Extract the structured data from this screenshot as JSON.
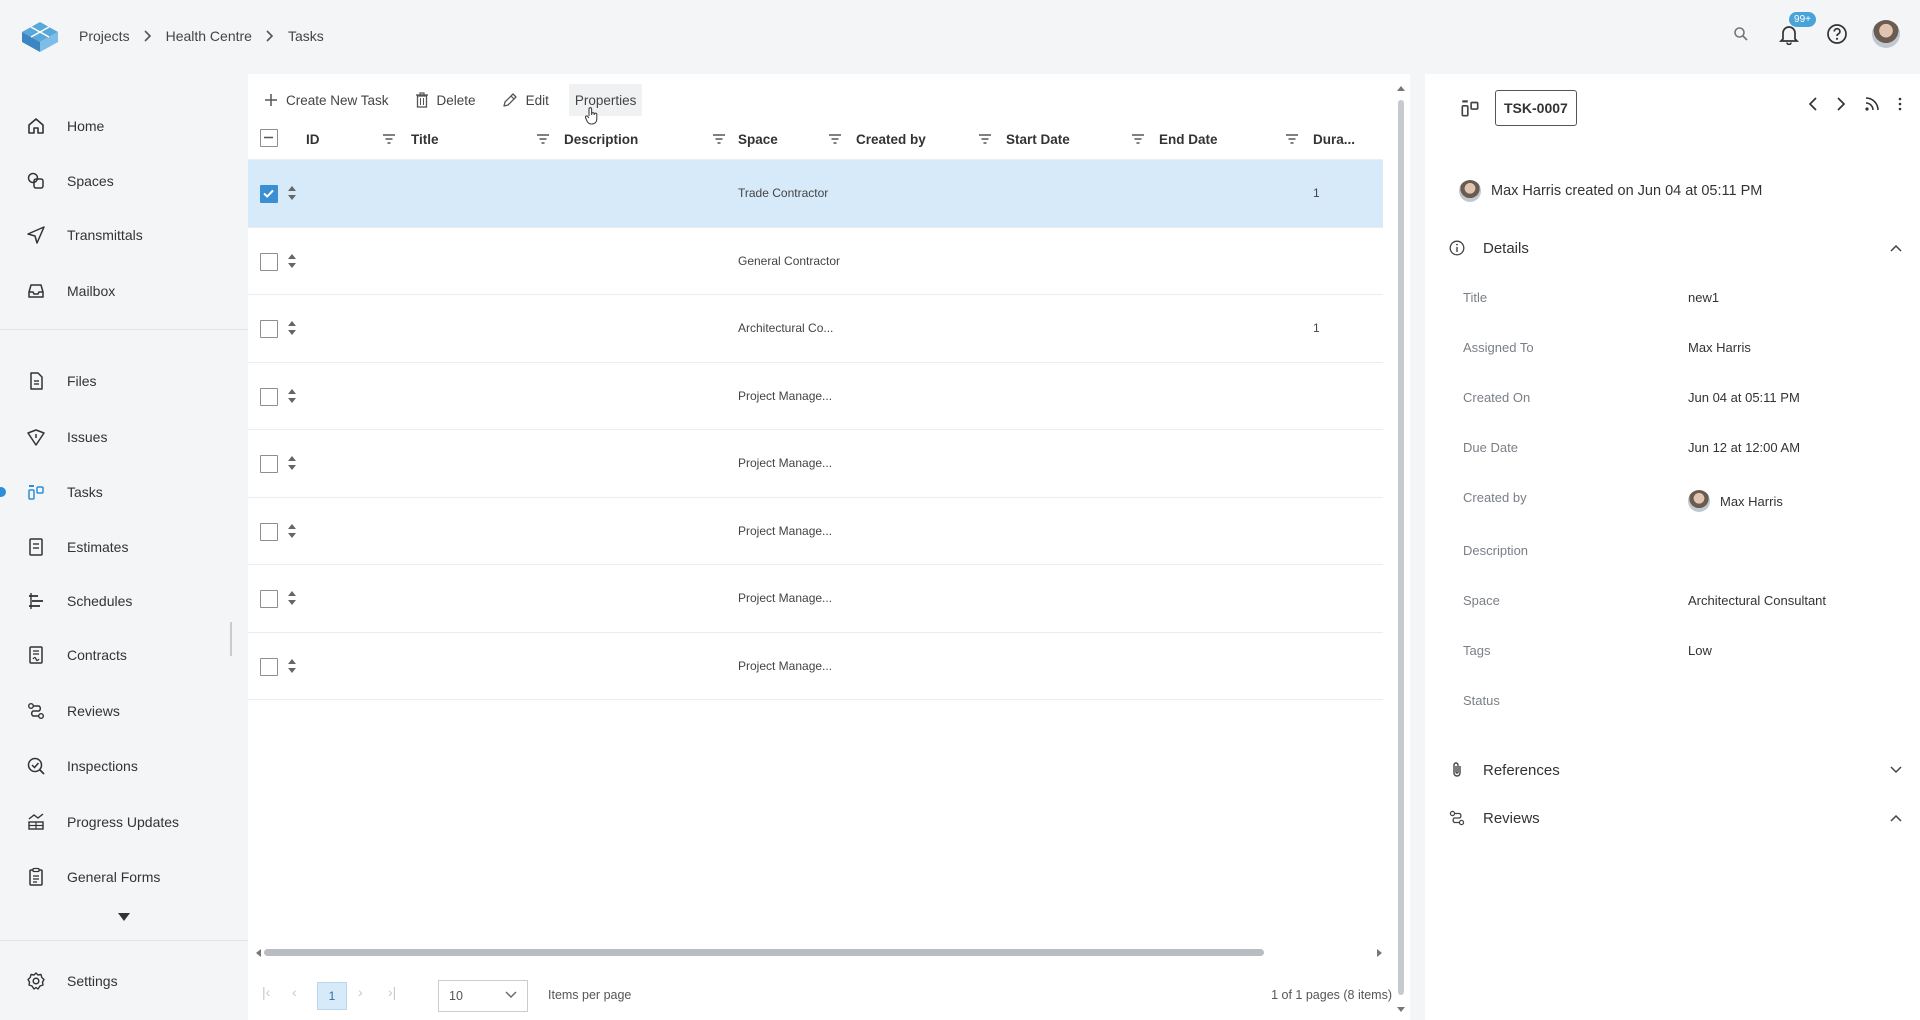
{
  "breadcrumb": [
    "Projects",
    "Health Centre",
    "Tasks"
  ],
  "notifications_badge": "99+",
  "sidebar": {
    "items": [
      {
        "label": "Home",
        "icon": "home-icon"
      },
      {
        "label": "Spaces",
        "icon": "spaces-icon"
      },
      {
        "label": "Transmittals",
        "icon": "send-icon"
      },
      {
        "label": "Mailbox",
        "icon": "inbox-icon"
      },
      {
        "label": "Files",
        "icon": "files-icon"
      },
      {
        "label": "Issues",
        "icon": "issues-icon"
      },
      {
        "label": "Tasks",
        "icon": "tasks-icon"
      },
      {
        "label": "Estimates",
        "icon": "estimates-icon"
      },
      {
        "label": "Schedules",
        "icon": "schedules-icon"
      },
      {
        "label": "Contracts",
        "icon": "contracts-icon"
      },
      {
        "label": "Reviews",
        "icon": "reviews-icon"
      },
      {
        "label": "Inspections",
        "icon": "inspections-icon"
      },
      {
        "label": "Progress Updates",
        "icon": "progress-icon"
      },
      {
        "label": "General Forms",
        "icon": "forms-icon"
      }
    ],
    "settings_label": "Settings",
    "active": "Tasks"
  },
  "toolbar": {
    "create_label": "Create New Task",
    "delete_label": "Delete",
    "edit_label": "Edit",
    "properties_label": "Properties"
  },
  "table": {
    "columns": [
      "ID",
      "Title",
      "Description",
      "Space",
      "Created by",
      "Start Date",
      "End Date",
      "Dura..."
    ],
    "rows": [
      {
        "space": "Trade Contractor",
        "duration": "1",
        "selected": true
      },
      {
        "space": "General Contractor",
        "duration": "",
        "selected": false
      },
      {
        "space": "Architectural Co...",
        "duration": "1",
        "selected": false
      },
      {
        "space": "Project Manage...",
        "duration": "",
        "selected": false
      },
      {
        "space": "Project Manage...",
        "duration": "",
        "selected": false
      },
      {
        "space": "Project Manage...",
        "duration": "",
        "selected": false
      },
      {
        "space": "Project Manage...",
        "duration": "",
        "selected": false
      },
      {
        "space": "Project Manage...",
        "duration": "",
        "selected": false
      }
    ]
  },
  "pager": {
    "current_page": "1",
    "per_page": "10",
    "per_page_label": "Items per page",
    "info": "1 of 1 pages (8 items)"
  },
  "details": {
    "task_id": "TSK-0007",
    "created_line": "Max Harris created on Jun 04 at 05:11 PM",
    "details_label": "Details",
    "fields": [
      {
        "label": "Title",
        "value": "new1"
      },
      {
        "label": "Assigned To",
        "value": "Max Harris"
      },
      {
        "label": "Created On",
        "value": "Jun 04 at 05:11 PM"
      },
      {
        "label": "Due Date",
        "value": "Jun 12 at 12:00 AM"
      },
      {
        "label": "Created by",
        "value": "Max Harris"
      },
      {
        "label": "Description",
        "value": ""
      },
      {
        "label": "Space",
        "value": "Architectural Consultant"
      },
      {
        "label": "Tags",
        "value": "Low"
      },
      {
        "label": "Status",
        "value": ""
      }
    ],
    "references_label": "References",
    "reviews_label": "Reviews"
  },
  "colors": {
    "accent": "#2b8fd6",
    "selected_row": "#d7eaf9",
    "badge": "#4aa3d8"
  }
}
